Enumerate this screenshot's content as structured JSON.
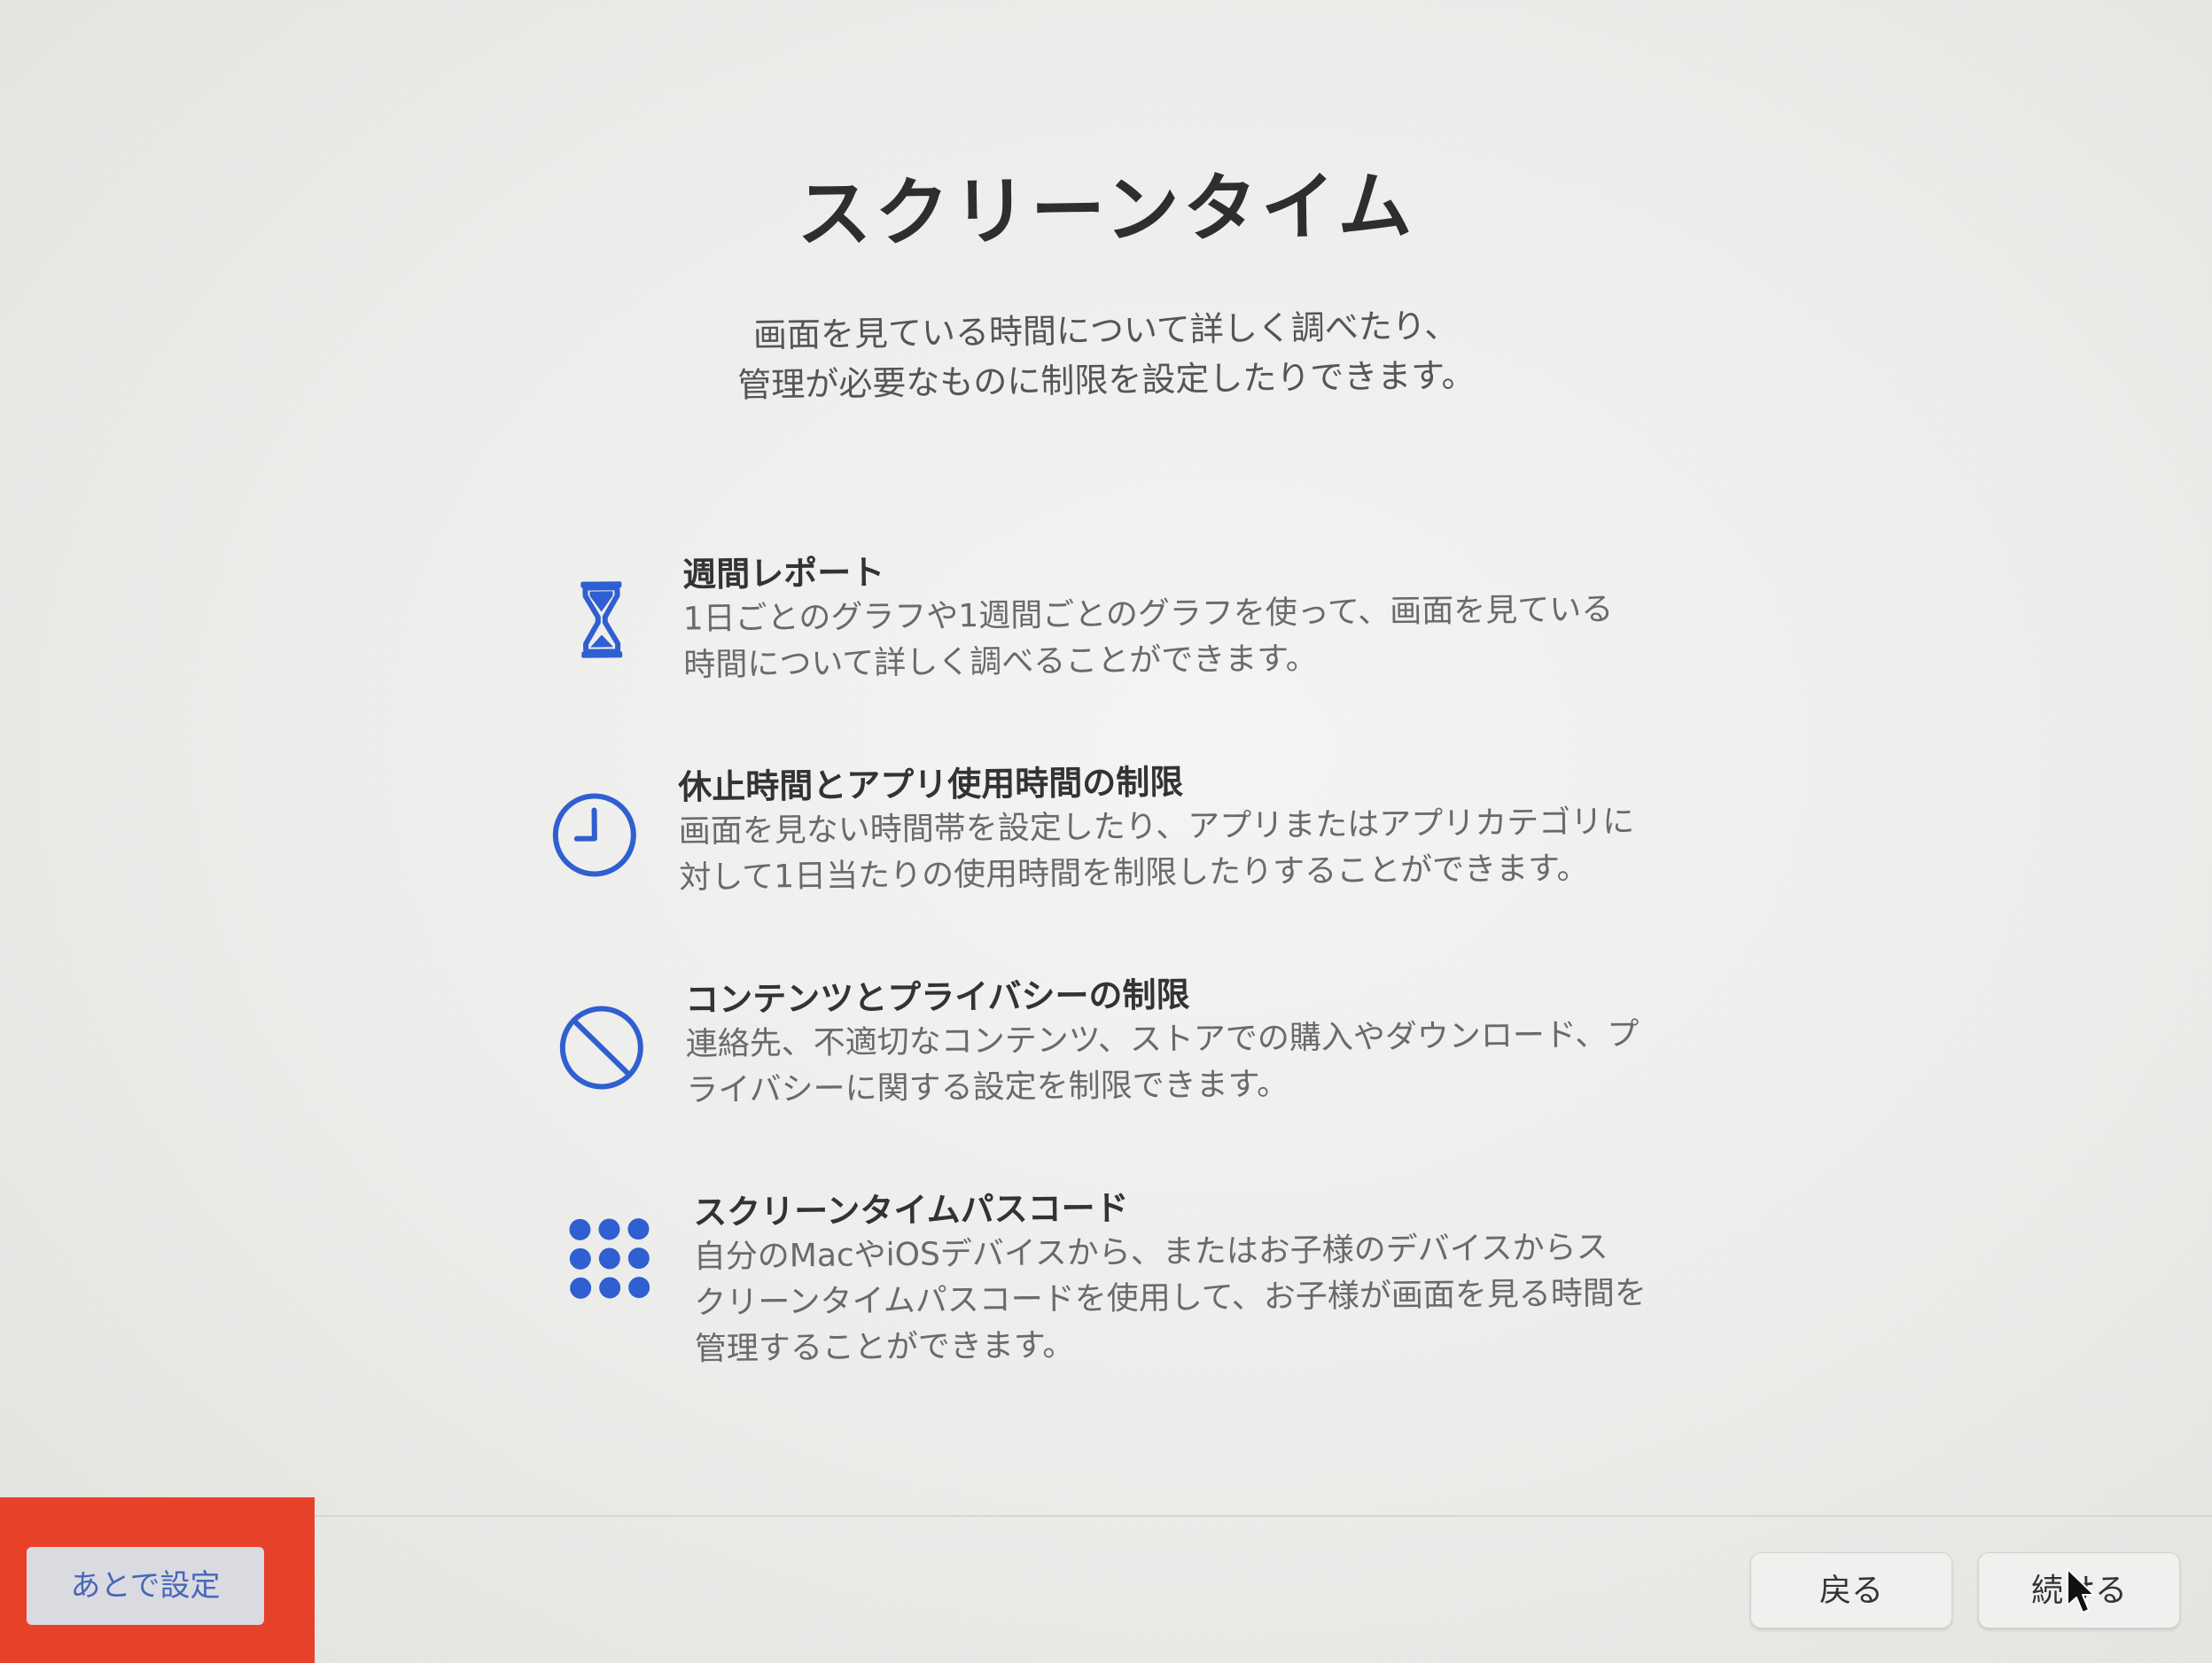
{
  "header": {
    "title": "スクリーンタイム",
    "subtitle_line1": "画面を見ている時間について詳しく調べたり、",
    "subtitle_line2": "管理が必要なものに制限を設定したりできます。"
  },
  "features": [
    {
      "icon": "hourglass-icon",
      "title": "週間レポート",
      "desc_line1": "1日ごとのグラフや1週間ごとのグラフを使って、画面を見ている",
      "desc_line2": "時間について詳しく調べることができます。",
      "desc_line3": ""
    },
    {
      "icon": "clock-icon",
      "title": "休止時間とアプリ使用時間の制限",
      "desc_line1": "画面を見ない時間帯を設定したり、アプリまたはアプリカテゴリに",
      "desc_line2": "対して1日当たりの使用時間を制限したりすることができます。",
      "desc_line3": ""
    },
    {
      "icon": "prohibited-icon",
      "title": "コンテンツとプライバシーの制限",
      "desc_line1": "連絡先、不適切なコンテンツ、ストアでの購入やダウンロード、プ",
      "desc_line2": "ライバシーに関する設定を制限できます。",
      "desc_line3": ""
    },
    {
      "icon": "keypad-icon",
      "title": "スクリーンタイムパスコード",
      "desc_line1": "自分のMacやiOSデバイスから、またはお子様のデバイスからス",
      "desc_line2": "クリーンタイムパスコードを使用して、お子様が画面を見る時間を",
      "desc_line3": "管理することができます。"
    }
  ],
  "footer": {
    "later_label": "あとで設定",
    "back_label": "戻る",
    "continue_label": "続ける"
  },
  "colors": {
    "accent_blue": "#2f5fd0",
    "highlight_red": "#e8412a"
  }
}
